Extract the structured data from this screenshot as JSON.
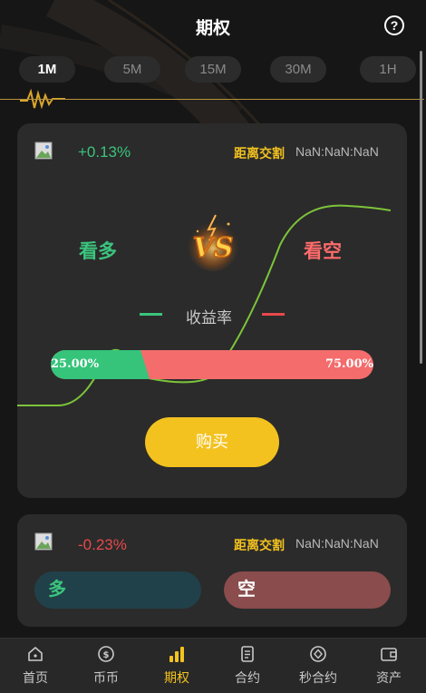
{
  "header": {
    "title": "期权",
    "help_icon": "question-circle-icon",
    "help_glyph": "?"
  },
  "tabs": [
    {
      "label": "1M",
      "active": true
    },
    {
      "label": "5M",
      "active": false
    },
    {
      "label": "15M",
      "active": false
    },
    {
      "label": "30M",
      "active": false
    },
    {
      "label": "1H",
      "active": false
    }
  ],
  "primary_card": {
    "change": "+0.13%",
    "countdown_label": "距离交割",
    "countdown_value": "NaN:NaN:NaN",
    "long_label": "看多",
    "short_label": "看空",
    "vs_label": "VS",
    "legend_label": "收益率",
    "long_ratio_text": "25.00%",
    "short_ratio_text": "75.00%",
    "long_ratio": 0.25,
    "buy_label": "购买"
  },
  "secondary_card": {
    "change": "-0.23%",
    "countdown_label": "距离交割",
    "countdown_value": "NaN:NaN:NaN",
    "long_button": "多",
    "short_button": "空"
  },
  "bottom_nav": [
    {
      "label": "首页",
      "icon": "home-icon",
      "active": false
    },
    {
      "label": "币币",
      "icon": "coin-icon",
      "active": false
    },
    {
      "label": "期权",
      "icon": "bar-chart-icon",
      "active": true
    },
    {
      "label": "合约",
      "icon": "document-icon",
      "active": false
    },
    {
      "label": "秒合约",
      "icon": "diamond-coin-icon",
      "active": false
    },
    {
      "label": "资产",
      "icon": "wallet-icon",
      "active": false
    }
  ],
  "colors": {
    "accent": "#f3c21f",
    "up": "#3bc47d",
    "down": "#e8494b",
    "card": "#2b2b2b",
    "background": "#161616"
  }
}
